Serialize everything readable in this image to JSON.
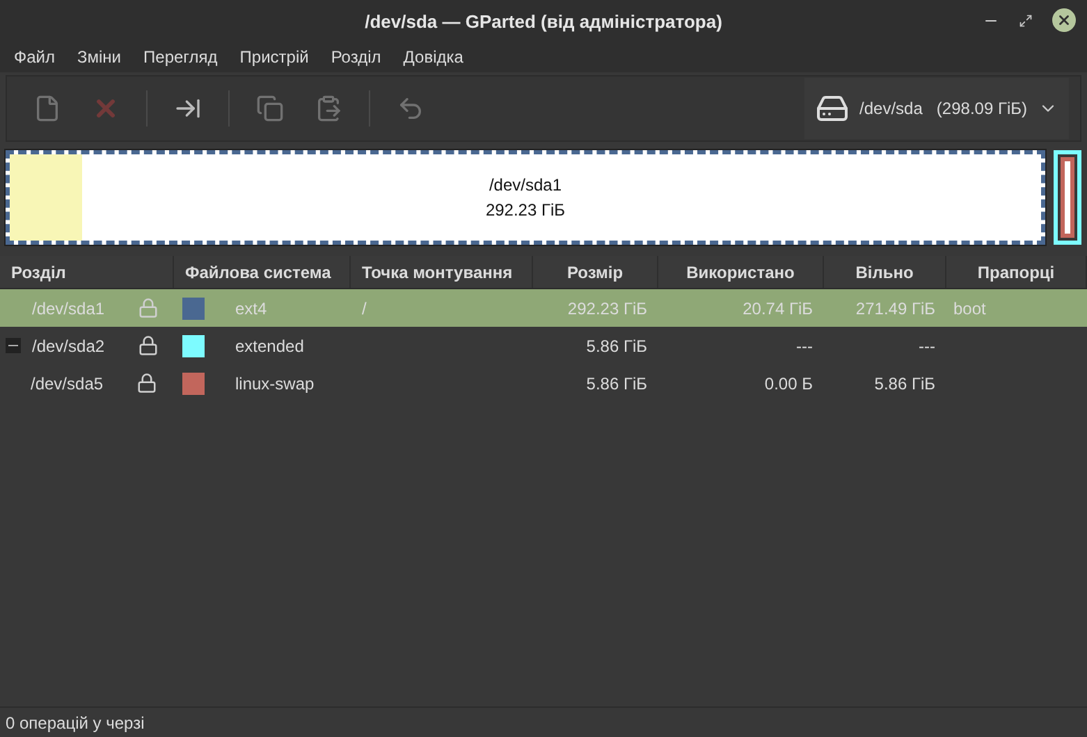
{
  "window": {
    "title": "/dev/sda — GParted (від адміністратора)"
  },
  "menu": [
    "Файл",
    "Зміни",
    "Перегляд",
    "Пристрій",
    "Розділ",
    "Довідка"
  ],
  "toolbar": [
    {
      "kind": "new",
      "disabled": true
    },
    {
      "kind": "delete",
      "disabled": true
    },
    {
      "kind": "resize",
      "disabled": false
    },
    {
      "kind": "copy",
      "disabled": true
    },
    {
      "kind": "paste",
      "disabled": true
    },
    {
      "kind": "undo",
      "disabled": true
    }
  ],
  "device": {
    "name": "/dev/sda",
    "size": "(298.09 ГіБ)"
  },
  "disk_map": {
    "primary": {
      "label": "/dev/sda1",
      "size": "292.23 ГіБ",
      "level": 0.07,
      "color": "#4a6891",
      "selected": true
    },
    "extended": {
      "color": "#7dfbff",
      "children": [
        {
          "color": "#c2665c"
        }
      ]
    }
  },
  "table": {
    "columns": [
      "Розділ",
      "Файлова система",
      "Точка монтування",
      "Розмір",
      "Використано",
      "Вільно",
      "Прапорці"
    ],
    "rows": [
      {
        "partition": "/dev/sda1",
        "color": "#4a6891",
        "filesystem": "ext4",
        "mount": "/",
        "size": "292.23 ГіБ",
        "used": "20.74 ГіБ",
        "free": "271.49 ГіБ",
        "flags": "boot",
        "selected": true
      },
      {
        "partition": "/dev/sda2",
        "color": "#7dfbff",
        "filesystem": "extended",
        "size": "5.86 ГіБ",
        "used": "---",
        "free": "---",
        "selected": false,
        "expanded": true,
        "children": [
          {
            "partition": "/dev/sda5",
            "color": "#c2665c",
            "filesystem": "linux-swap",
            "size": "5.86 ГіБ",
            "used": "0.00 Б",
            "free": "5.86 ГіБ",
            "selected": false
          }
        ]
      }
    ]
  },
  "status_bar": "0 операцій у черзі"
}
